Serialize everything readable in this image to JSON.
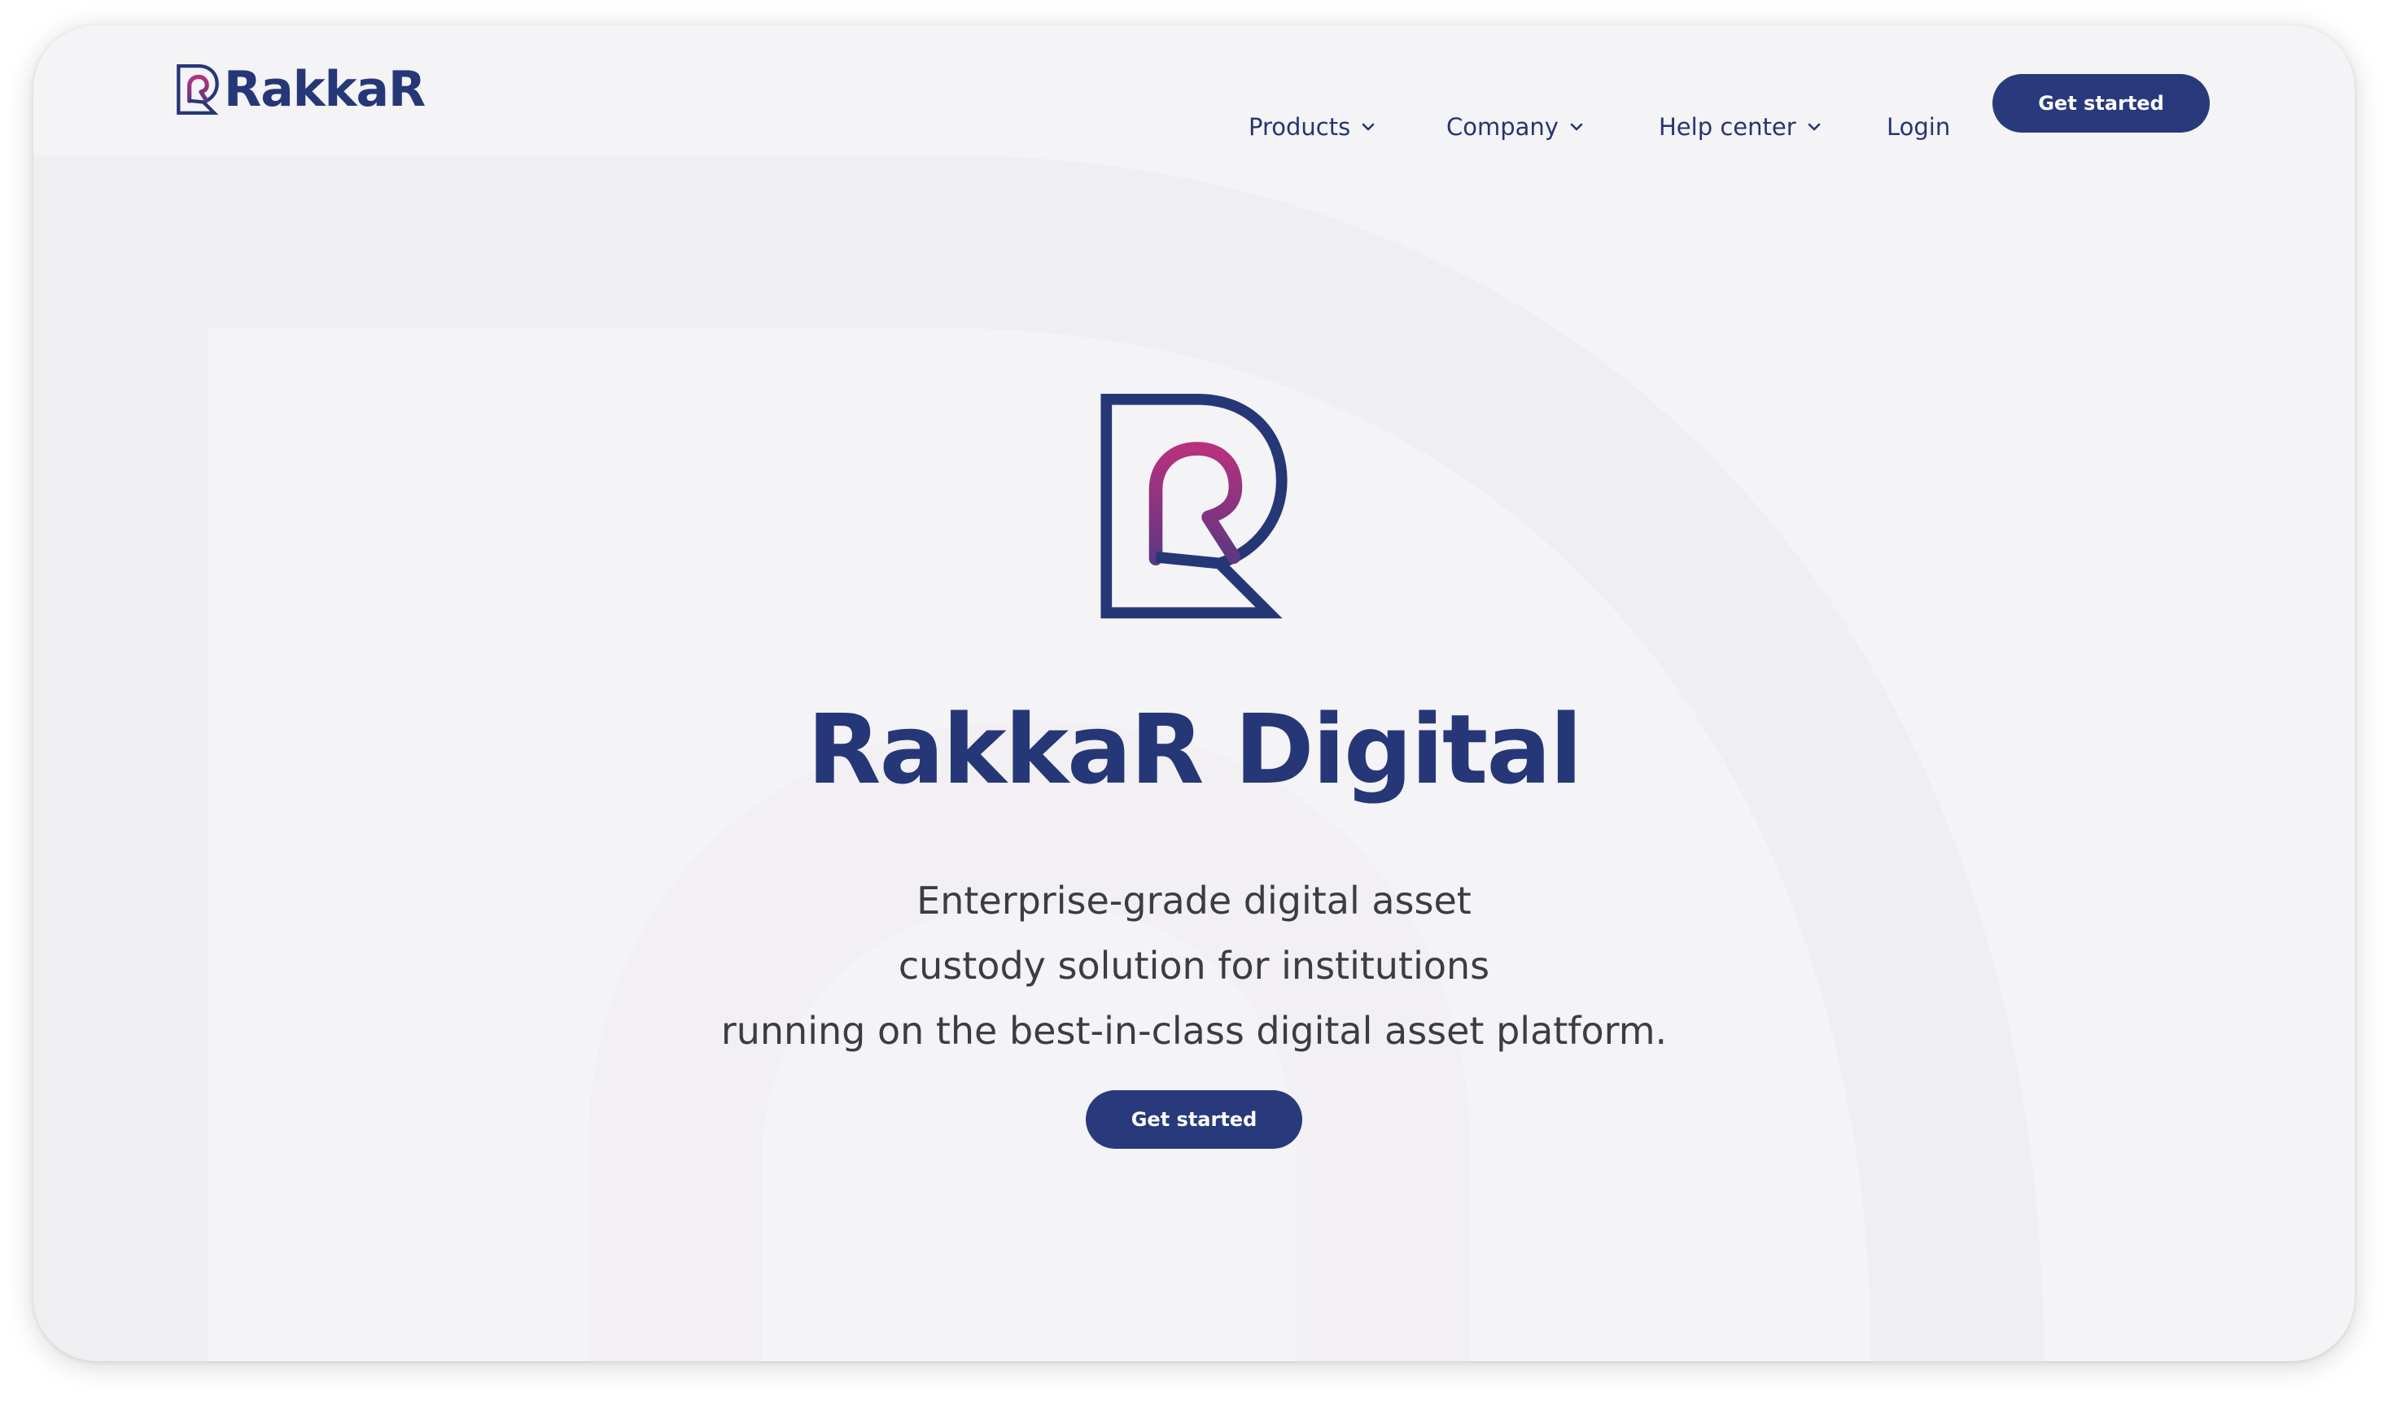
{
  "nav": {
    "brand": "RakkaR",
    "items": [
      {
        "label": "Products",
        "icon": "chevron-down-icon"
      },
      {
        "label": "Company",
        "icon": "chevron-down-icon"
      },
      {
        "label": "Help center",
        "icon": "chevron-down-icon"
      },
      {
        "label": "Login"
      }
    ],
    "cta_label": "Get started"
  },
  "hero": {
    "title": "RakkaR Digital",
    "subtitle_lines": [
      "Enterprise-grade digital asset",
      "custody solution for institutions",
      "running on the best-in-class digital asset platform."
    ],
    "cta_label": "Get started"
  },
  "colors": {
    "brand_navy": "#263778",
    "button_navy": "#283a7c",
    "logo_gradient_top": "#b7317e",
    "logo_gradient_bottom": "#5e3782",
    "background": "#f4f3f5",
    "text_body": "#3c3c44"
  }
}
